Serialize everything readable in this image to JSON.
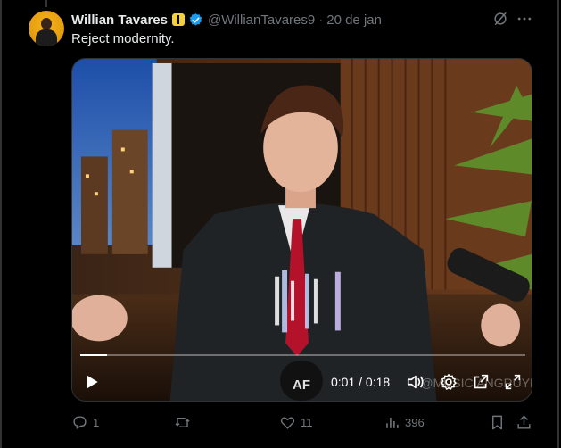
{
  "post": {
    "author": {
      "display_name": "Willian Tavares",
      "handle": "@WillianTavares9",
      "badges": [
        "yellow-flag-badge",
        "verified-icon"
      ]
    },
    "separator": "·",
    "date": "20 de jan",
    "text": "Reject modernity.",
    "header_icons": [
      "grok-icon",
      "more-icon"
    ]
  },
  "media": {
    "type": "video",
    "watermark": "@MUSICIANGRUYPR",
    "mic_logo": "AF",
    "player": {
      "time_readout": "0:01 / 0:18",
      "progress": 0.06,
      "controls": [
        "play-icon",
        "volume-icon",
        "settings-icon",
        "popout-icon",
        "fullscreen-icon"
      ]
    }
  },
  "actions": {
    "reply_count": "1",
    "repost_count": "",
    "like_count": "11",
    "view_count": "396"
  },
  "colors": {
    "background": "#000000",
    "text_primary": "#e7e9ea",
    "text_secondary": "#71767b",
    "verified": "#1d9bf0",
    "border": "#2f3336"
  }
}
